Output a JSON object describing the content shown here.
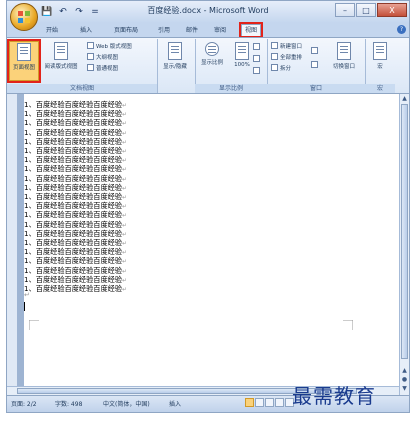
{
  "window": {
    "title": "百度经验.docx - Microsoft Word",
    "controls": [
      "–",
      "□",
      "X"
    ]
  },
  "qat": [
    "💾",
    "↶",
    "↷",
    "="
  ],
  "tabs": [
    "开始",
    "插入",
    "页面布局",
    "引用",
    "邮件",
    "审阅",
    "视图"
  ],
  "ribbon": {
    "groups": [
      "文档视图",
      "显示比例",
      "窗口",
      "宏"
    ],
    "page_view": "页面视图",
    "read_view": "阅读版式视图",
    "web_view": "Web 版式视图",
    "outline_view": "大纲视图",
    "draft_view": "普通视图",
    "show_hide": "显示/隐藏",
    "zoom": "显示比例",
    "zoom_pct": "100%",
    "new_window": "新建窗口",
    "arrange_all": "全部重排",
    "split": "拆分",
    "switch_window": "切换窗口",
    "macro": "宏"
  },
  "document": {
    "lines": [
      "1、百度经验百度经验百度经验",
      "1、百度经验百度经验百度经验",
      "1、百度经验百度经验百度经验",
      "1、百度经验百度经验百度经验",
      "1、百度经验百度经验百度经验",
      "1、百度经验百度经验百度经验",
      "1、百度经验百度经验百度经验",
      "1、百度经验百度经验百度经验",
      "1、百度经验百度经验百度经验",
      "1、百度经验百度经验百度经验",
      "1、百度经验百度经验百度经验",
      "1、百度经验百度经验百度经验",
      "1、百度经验百度经验百度经验",
      "1、百度经验百度经验百度经验",
      "1、百度经验百度经验百度经验",
      "1、百度经验百度经验百度经验",
      "1、百度经验百度经验百度经验",
      "1、百度经验百度经验百度经验",
      "1、百度经验百度经验百度经验",
      "1、百度经验百度经验百度经验",
      "1、百度经验百度经验百度经验"
    ],
    "para_mark": "↵"
  },
  "status": {
    "page": "页面: 2/2",
    "words": "字数: 498",
    "language": "中文(简体，中国)",
    "mode": "插入"
  },
  "watermark": "最需教育",
  "colors": {
    "highlight": "#e2231a",
    "selected": "#fbd27a",
    "ribbon": "#dbe7f6"
  }
}
